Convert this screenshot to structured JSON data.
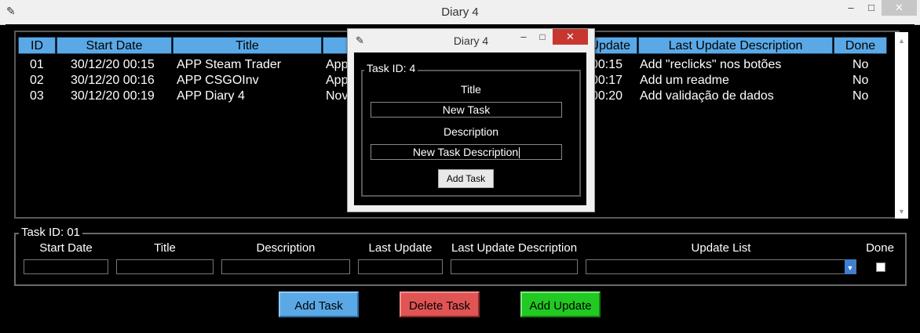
{
  "window": {
    "title": "Diary 4",
    "icon": "feather-icon",
    "min_glyph": "‒",
    "max_glyph": "□",
    "close_glyph": "✕"
  },
  "table": {
    "headers": [
      "ID",
      "Start Date",
      "Title",
      "",
      "Last Update",
      "Last Update Description",
      "Done"
    ],
    "rows": [
      {
        "id": "01",
        "start_date": "30/12/20  00:15",
        "title": "APP Steam Trader",
        "description": "App",
        "last_update": "00:15",
        "last_update_desc": "Add \"reclicks\" nos botões",
        "done": "No"
      },
      {
        "id": "02",
        "start_date": "30/12/20  00:16",
        "title": "APP CSGOInv",
        "description": "App",
        "last_update": "00:17",
        "last_update_desc": "Add um readme",
        "done": "No"
      },
      {
        "id": "03",
        "start_date": "30/12/20  00:19",
        "title": "APP Diary 4",
        "description": "Nov",
        "last_update": "00:20",
        "last_update_desc": "Add validação de dados",
        "done": "No"
      }
    ]
  },
  "form": {
    "legend": "Task ID:  01",
    "labels": {
      "start_date": "Start Date",
      "title": "Title",
      "description": "Description",
      "last_update": "Last Update",
      "last_update_desc": "Last Update Description",
      "update_list": "Update List",
      "done": "Done"
    },
    "done_checked": false
  },
  "buttons": {
    "add_task": "Add Task",
    "delete_task": "Delete Task",
    "add_update": "Add Update"
  },
  "dialog": {
    "title": "Diary 4",
    "legend": "Task ID:  4",
    "title_label": "Title",
    "title_value": "New Task",
    "description_label": "Description",
    "description_value": "New Task Description",
    "add_button": "Add Task",
    "close_glyph": "✕"
  },
  "colors": {
    "add_task": "#5aa9e6",
    "delete_task": "#e05454",
    "add_update": "#22c922",
    "header": "#5aa9e6"
  }
}
